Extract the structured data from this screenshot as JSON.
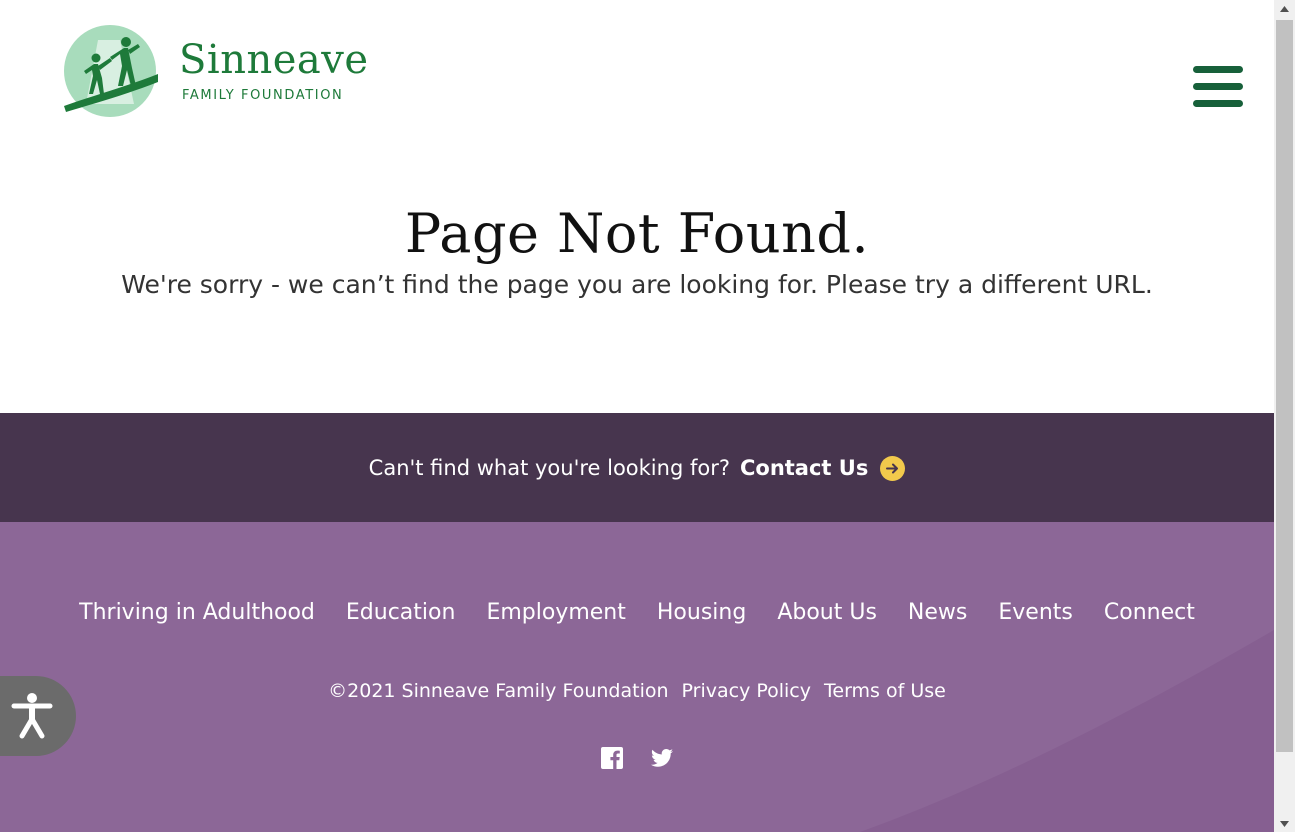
{
  "brand": {
    "name": "Sinneave",
    "subtitle": "FAMILY FOUNDATION",
    "green": "#1e7a3a",
    "dark_green": "#17603a",
    "light_green": "#a8dcbc"
  },
  "header": {
    "menu_icon": "hamburger-menu-icon"
  },
  "main": {
    "title": "Page Not Found.",
    "message": "We're sorry - we can’t find the page you are looking for. Please try a different URL."
  },
  "contact_band": {
    "question": "Can't find what you're looking for?",
    "link_label": "Contact Us",
    "link_icon": "arrow-right-circle-icon",
    "background": "#47354e",
    "accent": "#f2c94c"
  },
  "footer": {
    "background": "#8c6797",
    "nav": [
      {
        "label": "Thriving in Adulthood"
      },
      {
        "label": "Education"
      },
      {
        "label": "Employment"
      },
      {
        "label": "Housing"
      },
      {
        "label": "About Us"
      },
      {
        "label": "News"
      },
      {
        "label": "Events"
      },
      {
        "label": "Connect"
      }
    ],
    "copyright": "©2021 Sinneave Family Foundation",
    "privacy": "Privacy Policy",
    "terms": "Terms of Use",
    "social": [
      "facebook-icon",
      "twitter-icon"
    ]
  },
  "accessibility": {
    "icon": "accessibility-icon"
  }
}
